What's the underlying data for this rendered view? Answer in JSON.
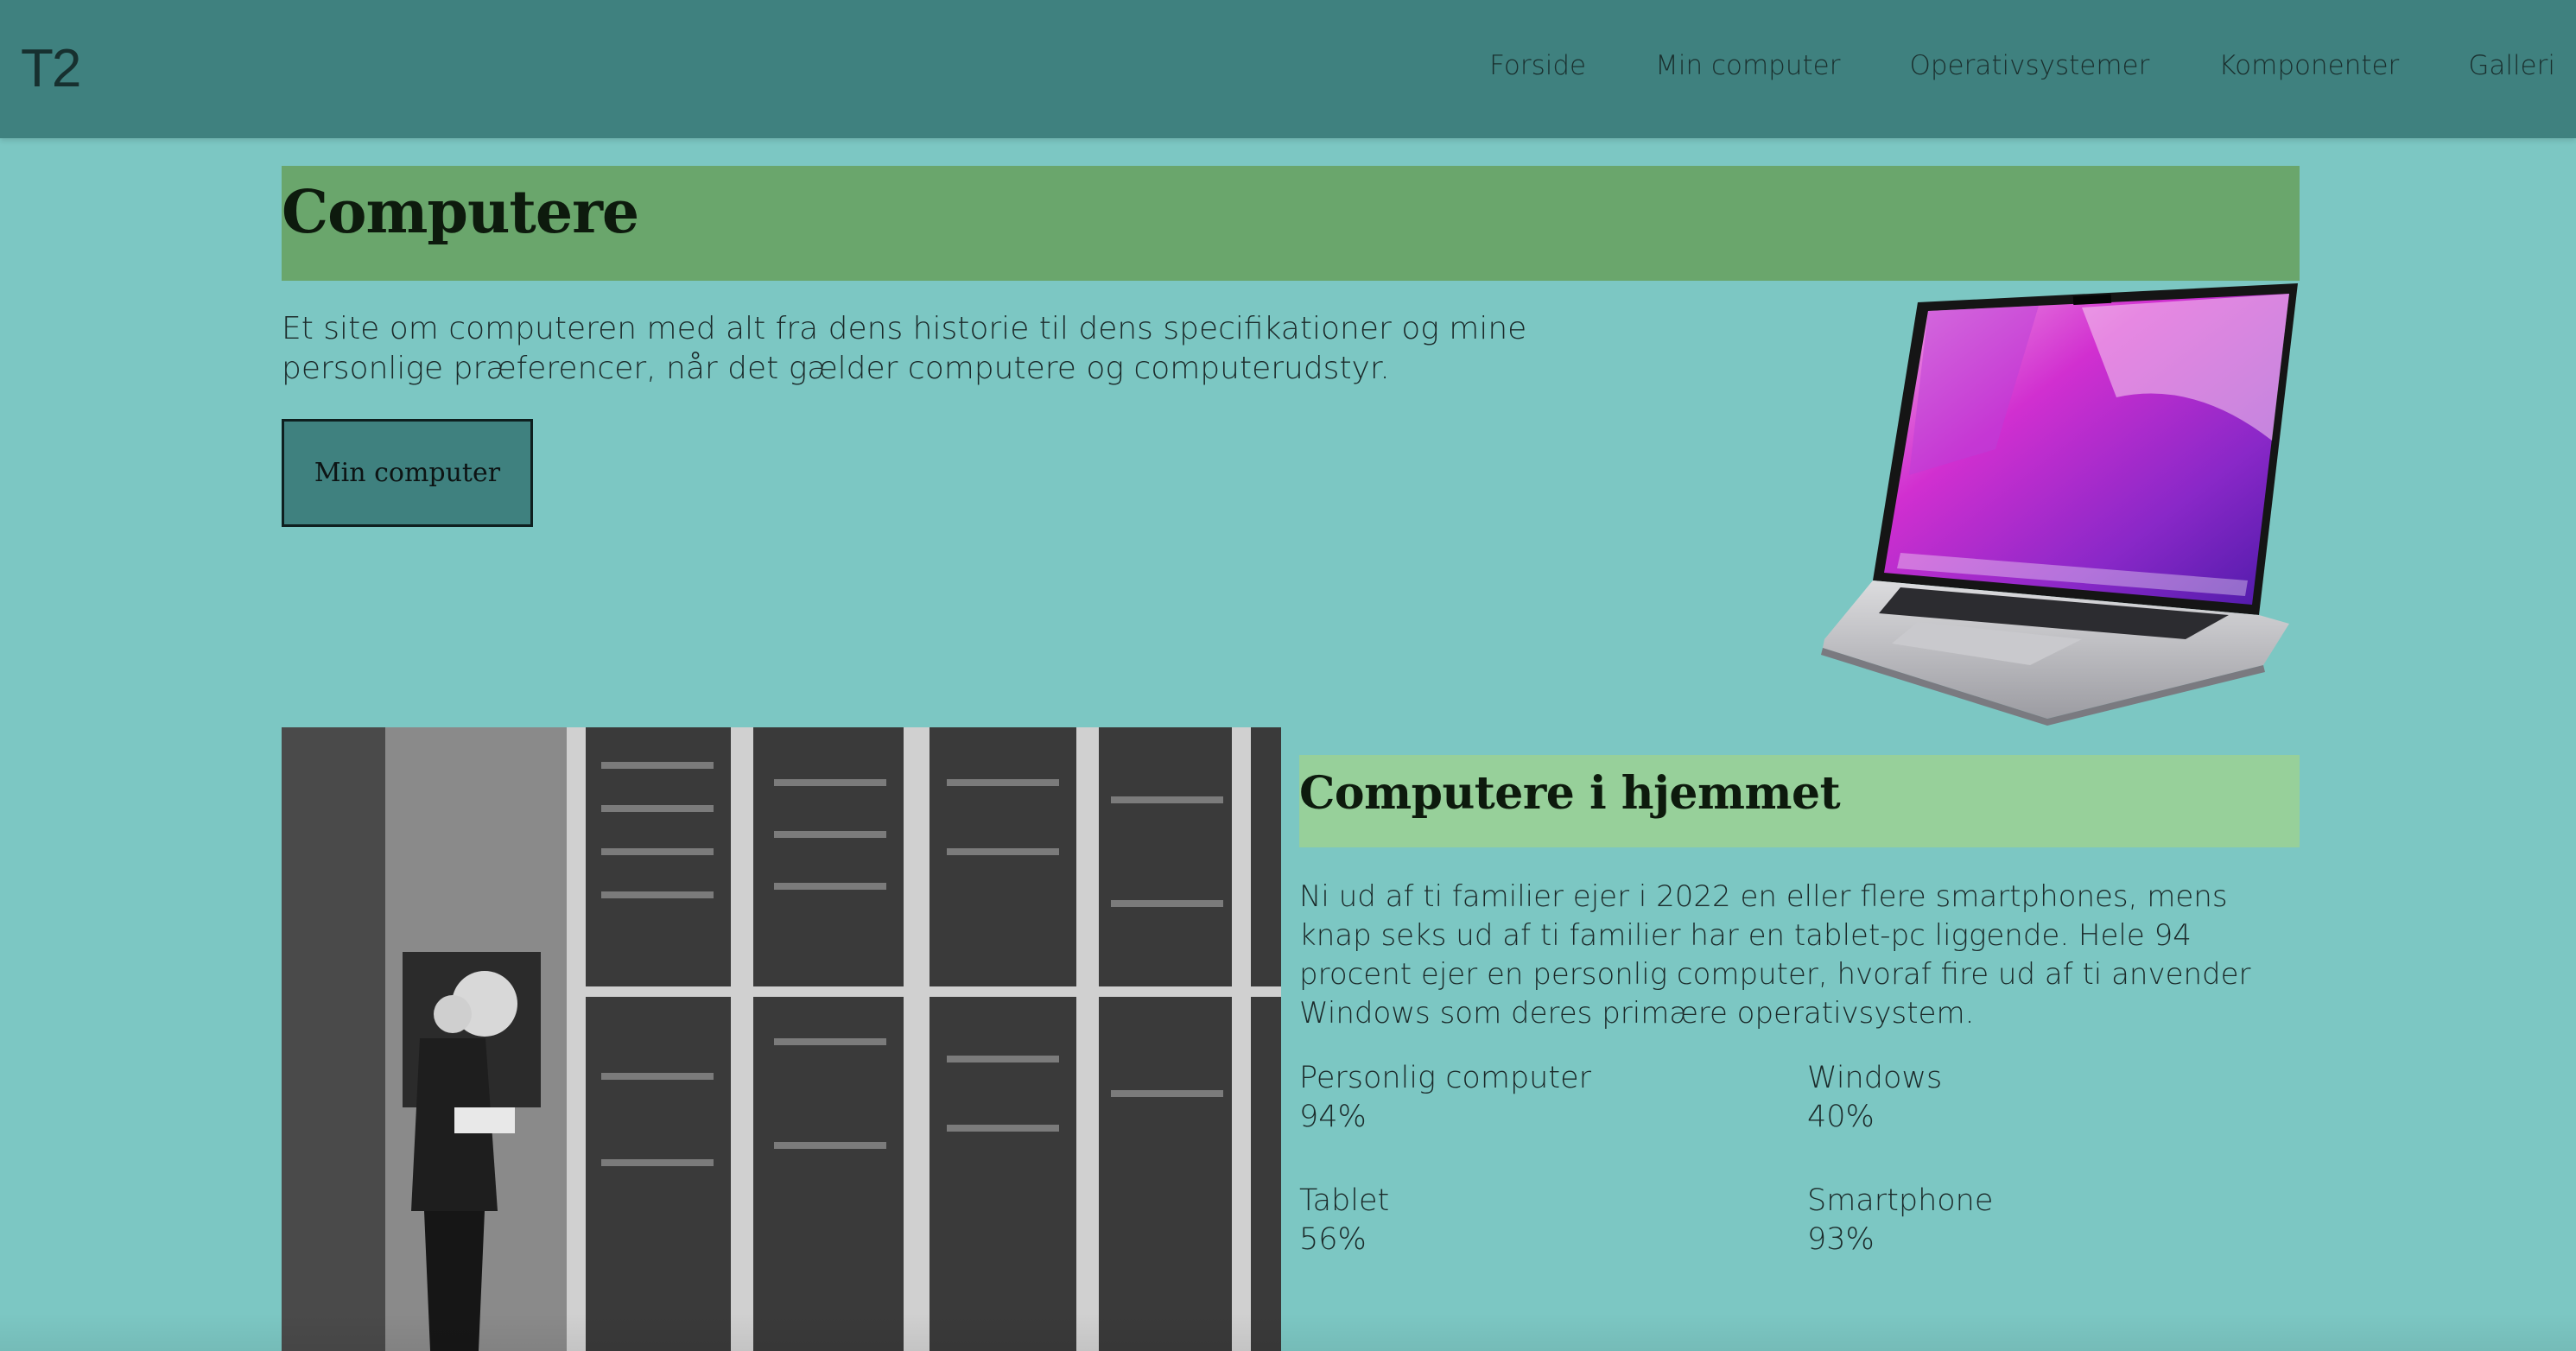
{
  "header": {
    "logo": "T2",
    "nav": [
      {
        "label": "Forside"
      },
      {
        "label": "Min computer"
      },
      {
        "label": "Operativsystemer"
      },
      {
        "label": "Komponenter"
      },
      {
        "label": "Galleri"
      }
    ]
  },
  "hero": {
    "title": "Computere",
    "text": "Et site om computeren med alt fra dens historie til dens specifikationer og mine personlige præferencer, når det gælder computere og computerudstyr.",
    "button_label": "Min computer"
  },
  "home_section": {
    "title": "Computere i hjemmet",
    "text": "Ni ud af ti familier ejer i 2022 en eller flere smartphones, mens knap seks ud af ti familier har en tablet-pc liggende. Hele 94 procent ejer en personlig computer, hvoraf fire ud af ti anvender Windows som deres primære operativsystem.",
    "stats": [
      {
        "label": "Personlig computer",
        "value": "94%"
      },
      {
        "label": "Windows",
        "value": "40%"
      },
      {
        "label": "Tablet",
        "value": "56%"
      },
      {
        "label": "Smartphone",
        "value": "93%"
      }
    ]
  },
  "colors": {
    "page_bg": "#7cc7c3",
    "header_bg": "#3f817f",
    "hero_bar": "#6aa66c",
    "section_bar": "#97d09a",
    "button_bg": "#3f817f"
  }
}
